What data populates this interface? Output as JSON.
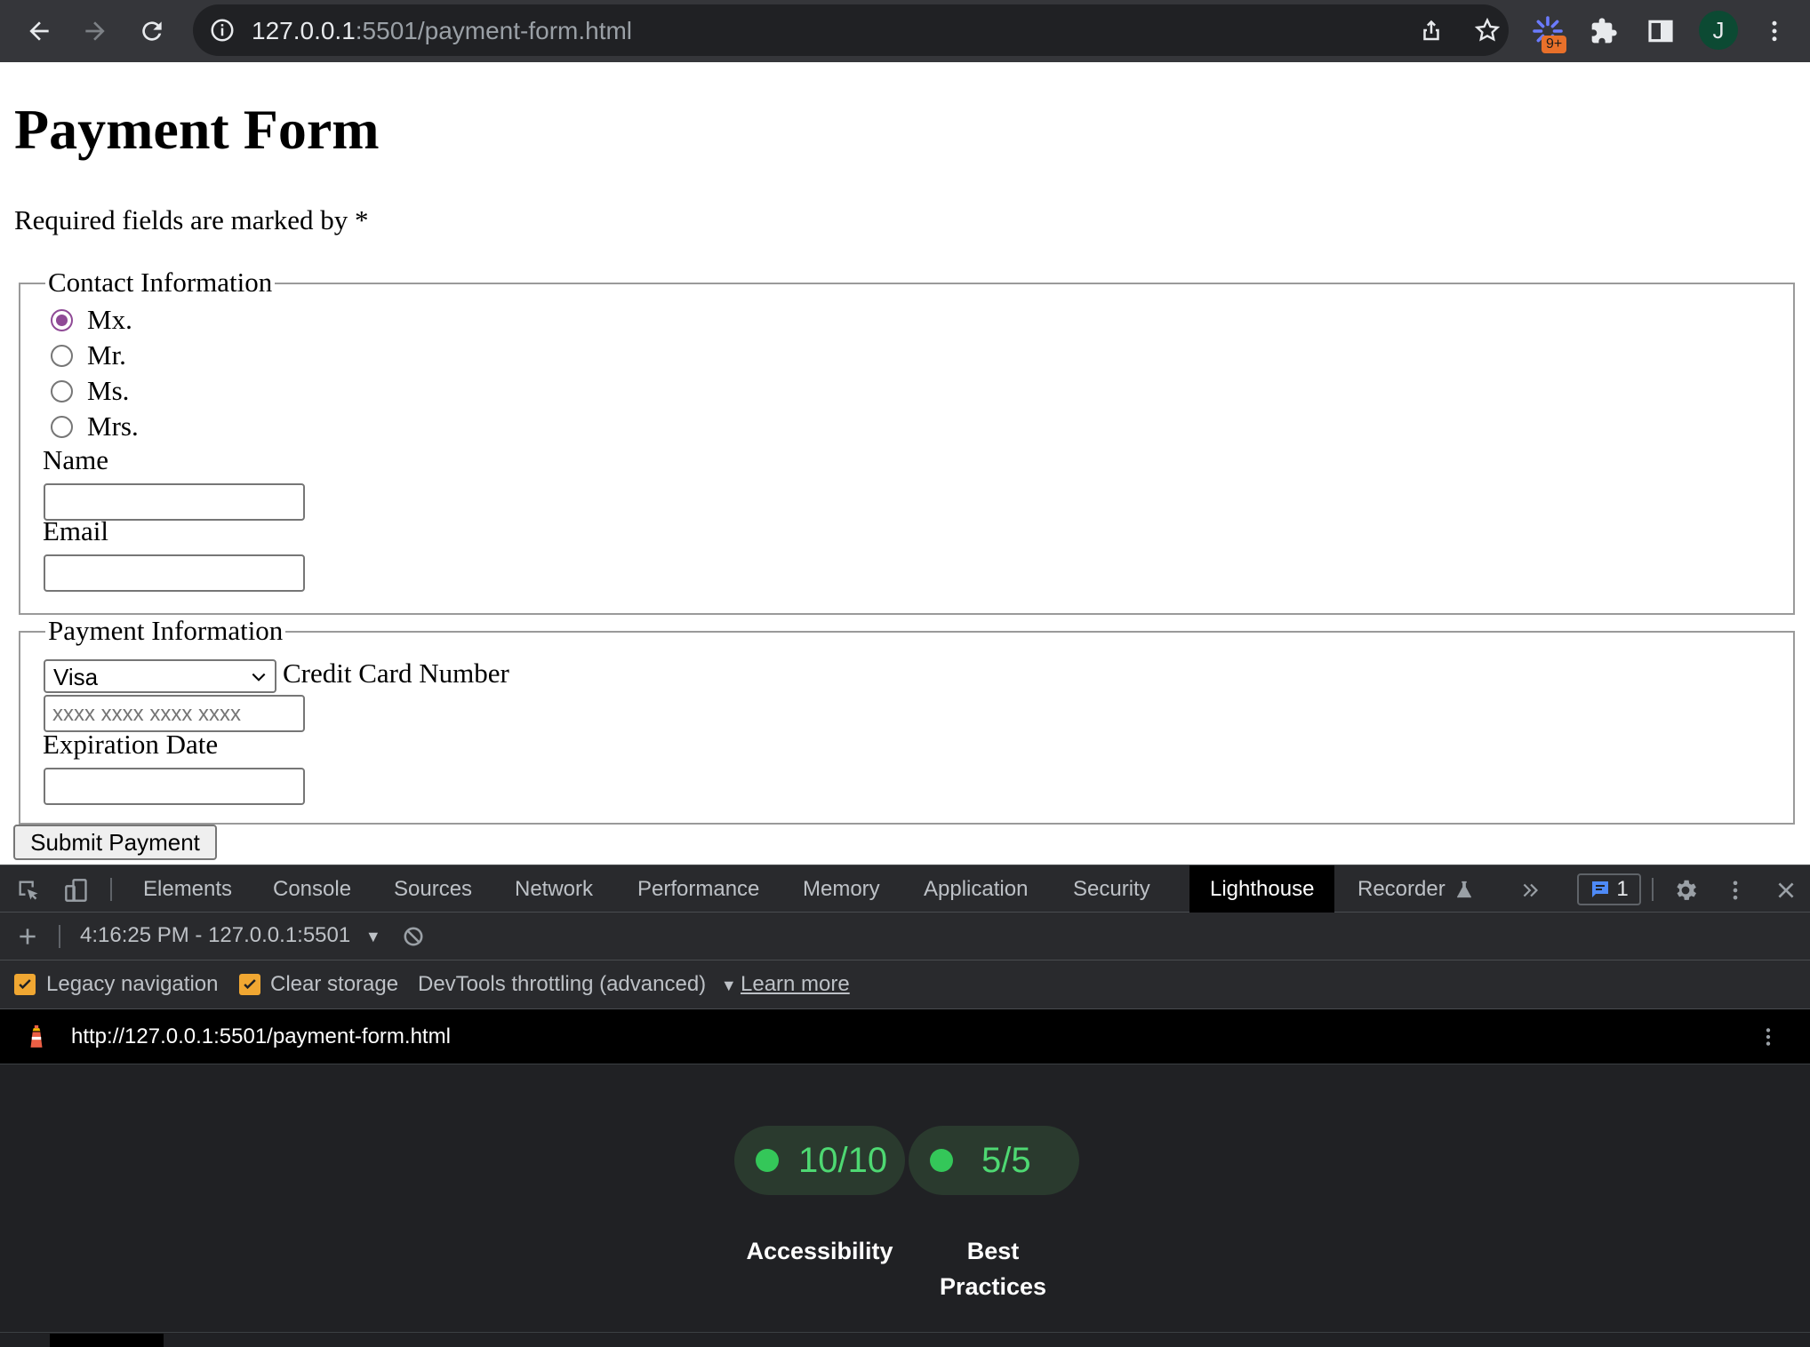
{
  "browser": {
    "url_host": "127.0.0.1",
    "url_rest": ":5501/payment-form.html",
    "extension_badge": "9+",
    "profile_initial": "J"
  },
  "page": {
    "title": "Payment Form",
    "required_note": "Required fields are marked by *",
    "contact": {
      "legend": "Contact Information",
      "honorifics": [
        {
          "label": "Mx.",
          "checked": true
        },
        {
          "label": "Mr.",
          "checked": false
        },
        {
          "label": "Ms.",
          "checked": false
        },
        {
          "label": "Mrs.",
          "checked": false
        }
      ],
      "name_label": "Name",
      "name_value": "",
      "email_label": "Email",
      "email_value": ""
    },
    "payment": {
      "legend": "Payment Information",
      "card_type": "Visa",
      "card_number_label": "Credit Card Number",
      "card_number_placeholder": "xxxx xxxx xxxx xxxx",
      "expiration_label": "Expiration Date",
      "expiration_value": ""
    },
    "submit_label": "Submit Payment"
  },
  "devtools": {
    "tabs": [
      "Elements",
      "Console",
      "Sources",
      "Network",
      "Performance",
      "Memory",
      "Application",
      "Security",
      "Lighthouse",
      "Recorder"
    ],
    "active_tab": "Lighthouse",
    "issues_count": "1",
    "report_selector": "4:16:25 PM - 127.0.0.1:5501",
    "settings": {
      "legacy_navigation": {
        "label": "Legacy navigation",
        "checked": true
      },
      "clear_storage": {
        "label": "Clear storage",
        "checked": true
      },
      "throttling": "DevTools throttling (advanced)",
      "learn_more": "Learn more"
    },
    "report_url": "http://127.0.0.1:5501/payment-form.html",
    "scores": [
      {
        "score": "10/10",
        "category": "Accessibility",
        "status": "pass"
      },
      {
        "score": "5/5",
        "category": "Best Practices",
        "status": "pass"
      }
    ],
    "colors": {
      "pass": "#34c759",
      "accent": "#f0a732",
      "radio_checked": "#8f4a96"
    }
  }
}
